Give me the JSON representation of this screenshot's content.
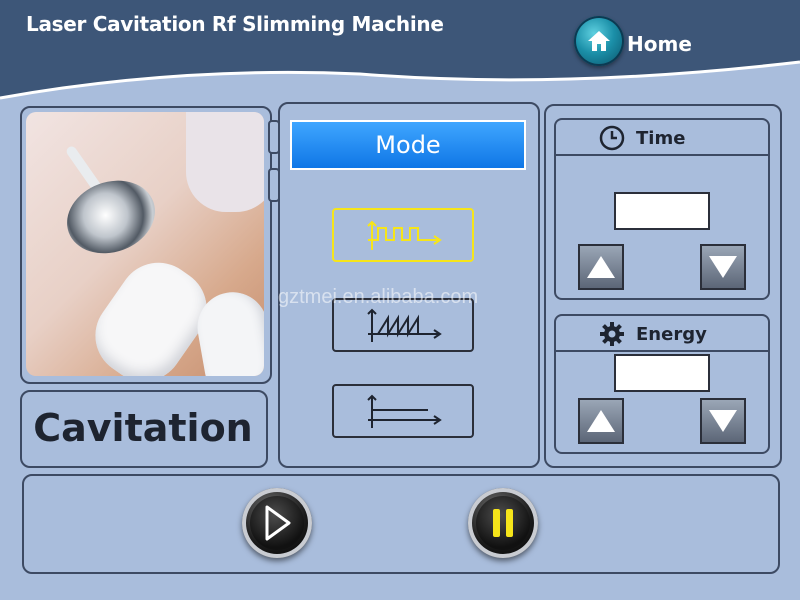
{
  "header": {
    "title": "Laser Cavitation Rf Slimming Machine",
    "home_label": "Home",
    "home_icon": "home-icon"
  },
  "colors": {
    "background": "#a9bddc",
    "header": "#3d5678",
    "mode_title_bg": "#1e88f0",
    "selected_outline": "#f6e51a",
    "pause_icon": "#f6e51a"
  },
  "left": {
    "photo": "treatment-photo",
    "mode_name": "Cavitation"
  },
  "mode_panel": {
    "title": "Mode",
    "waveforms": [
      {
        "icon": "square-wave-icon",
        "selected": true
      },
      {
        "icon": "sawtooth-wave-icon",
        "selected": false
      },
      {
        "icon": "continuous-wave-icon",
        "selected": false
      }
    ]
  },
  "time_panel": {
    "title": "Time",
    "icon": "clock-icon",
    "value": ""
  },
  "energy_panel": {
    "title": "Energy",
    "icon": "gear-icon",
    "value": ""
  },
  "controls": {
    "start_icon": "play-icon",
    "pause_icon": "pause-icon"
  },
  "watermark": "gztmei.en.alibaba.com"
}
